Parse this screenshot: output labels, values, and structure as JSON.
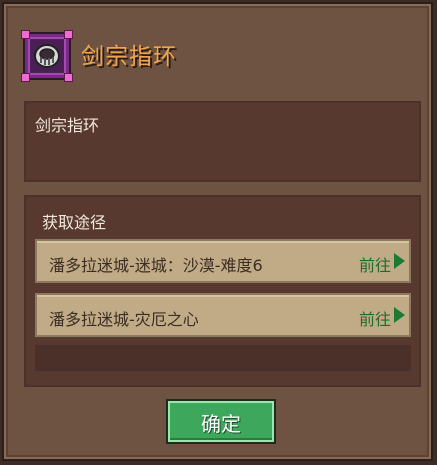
{
  "item": {
    "name": "剑宗指环",
    "icon": "ring-icon",
    "description": "剑宗指环"
  },
  "sources": {
    "heading": "获取途径",
    "rows": [
      {
        "label": "潘多拉迷城-迷城：沙漠-难度6",
        "action": "前往"
      },
      {
        "label": "潘多拉迷城-灾厄之心",
        "action": "前往"
      }
    ]
  },
  "footer": {
    "ok_label": "确定"
  },
  "colors": {
    "title": "#f0a54a",
    "goto_text": "#1f6d2e",
    "button": "#3da85b",
    "panel": "#57392f",
    "row": "#c1ab86"
  }
}
